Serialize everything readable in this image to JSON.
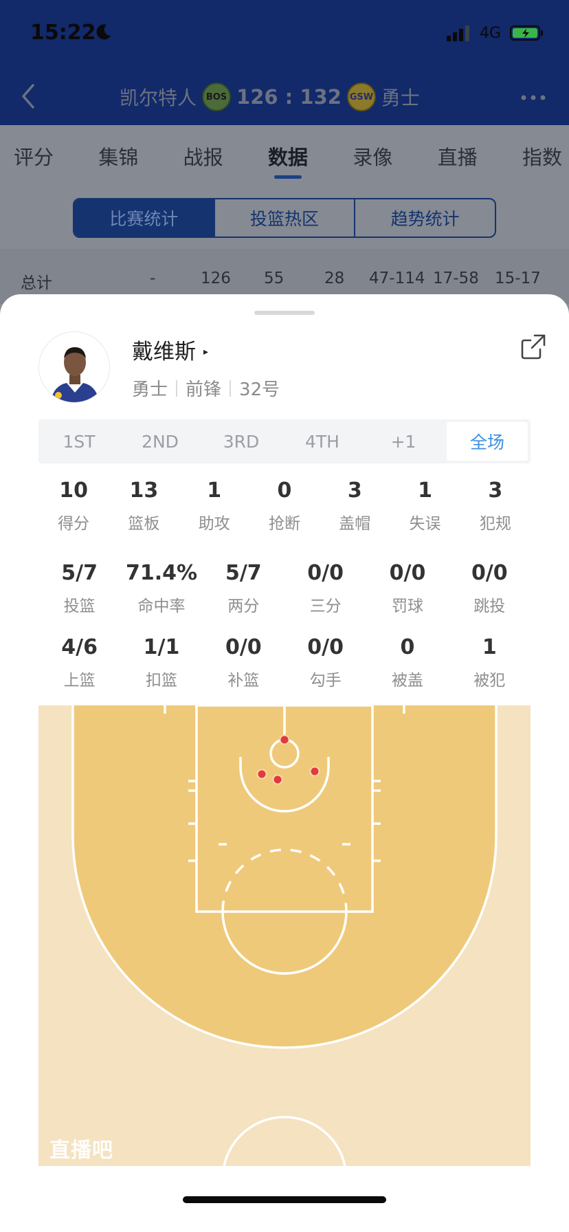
{
  "status_bar": {
    "time": "15:22",
    "network": "4G"
  },
  "header": {
    "home_team": "凯尔特人",
    "home_logo": "BOS",
    "score": "126 : 132",
    "away_logo": "GSW",
    "away_team": "勇士"
  },
  "main_tabs": [
    {
      "label": "评分",
      "active": false
    },
    {
      "label": "集锦",
      "active": false
    },
    {
      "label": "战报",
      "active": false
    },
    {
      "label": "数据",
      "active": true
    },
    {
      "label": "录像",
      "active": false
    },
    {
      "label": "直播",
      "active": false
    },
    {
      "label": "指数",
      "active": false
    }
  ],
  "segments": [
    {
      "label": "比赛统计",
      "active": true
    },
    {
      "label": "投篮热区",
      "active": false
    },
    {
      "label": "趋势统计",
      "active": false
    }
  ],
  "totals": [
    "总计",
    "-",
    "126",
    "55",
    "28",
    "47-114",
    "17-58",
    "15-17"
  ],
  "player": {
    "name": "戴维斯",
    "arrow": "▸",
    "team": "勇士",
    "position": "前锋",
    "number": "32号"
  },
  "periods": [
    {
      "label": "1ST",
      "active": false
    },
    {
      "label": "2ND",
      "active": false
    },
    {
      "label": "3RD",
      "active": false
    },
    {
      "label": "4TH",
      "active": false
    },
    {
      "label": "+1",
      "active": false
    },
    {
      "label": "全场",
      "active": true
    }
  ],
  "stats_row1": [
    {
      "value": "10",
      "label": "得分"
    },
    {
      "value": "13",
      "label": "篮板"
    },
    {
      "value": "1",
      "label": "助攻"
    },
    {
      "value": "0",
      "label": "抢断"
    },
    {
      "value": "3",
      "label": "盖帽"
    },
    {
      "value": "1",
      "label": "失误"
    },
    {
      "value": "3",
      "label": "犯规"
    }
  ],
  "stats_row2": [
    {
      "value": "5/7",
      "label": "投篮"
    },
    {
      "value": "71.4%",
      "label": "命中率"
    },
    {
      "value": "5/7",
      "label": "两分"
    },
    {
      "value": "0/0",
      "label": "三分"
    },
    {
      "value": "0/0",
      "label": "罚球"
    },
    {
      "value": "0/0",
      "label": "跳投"
    }
  ],
  "stats_row3": [
    {
      "value": "4/6",
      "label": "上篮"
    },
    {
      "value": "1/1",
      "label": "扣篮"
    },
    {
      "value": "0/0",
      "label": "补篮"
    },
    {
      "value": "0/0",
      "label": "勾手"
    },
    {
      "value": "0",
      "label": "被盖"
    },
    {
      "value": "1",
      "label": "被犯"
    }
  ],
  "shot_chart": {
    "made_marker_color": "#e03a3a",
    "court_paint_color": "#efc97a",
    "court_floor_color": "#f4e2c0"
  },
  "watermark": "直播吧",
  "colors": {
    "header_bg": "#12296a",
    "accent_blue": "#3d8fe0",
    "segment_navy": "#15336e"
  }
}
